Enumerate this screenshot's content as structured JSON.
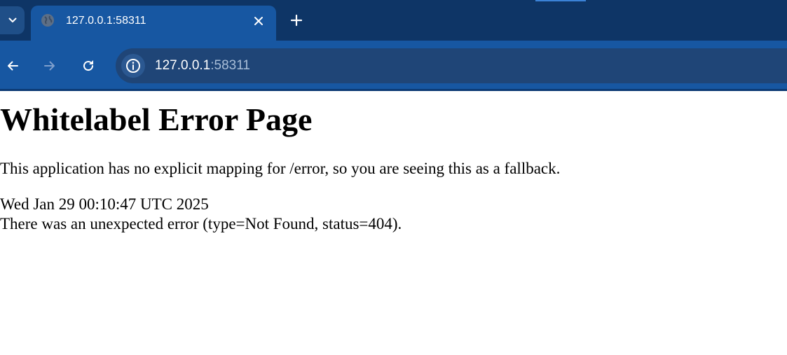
{
  "browser": {
    "tab": {
      "title": "127.0.0.1:58311"
    },
    "address_bar": {
      "host": "127.0.0.1",
      "port": ":58311"
    },
    "colors": {
      "tabstrip": "#0e3566",
      "active_tab": "#1757a2",
      "omnibox": "#1f4577"
    },
    "icons": {
      "tab_search": "chevron-down-icon",
      "favicon": "globe-icon",
      "close_tab": "close-icon",
      "new_tab": "plus-icon",
      "back": "arrow-left-icon",
      "forward": "arrow-right-icon",
      "reload": "reload-icon",
      "site_info": "info-icon"
    }
  },
  "page": {
    "heading": "Whitelabel Error Page",
    "description": "This application has no explicit mapping for /error, so you are seeing this as a fallback.",
    "timestamp": "Wed Jan 29 00:10:47 UTC 2025",
    "error_message": "There was an unexpected error (type=Not Found, status=404)."
  }
}
